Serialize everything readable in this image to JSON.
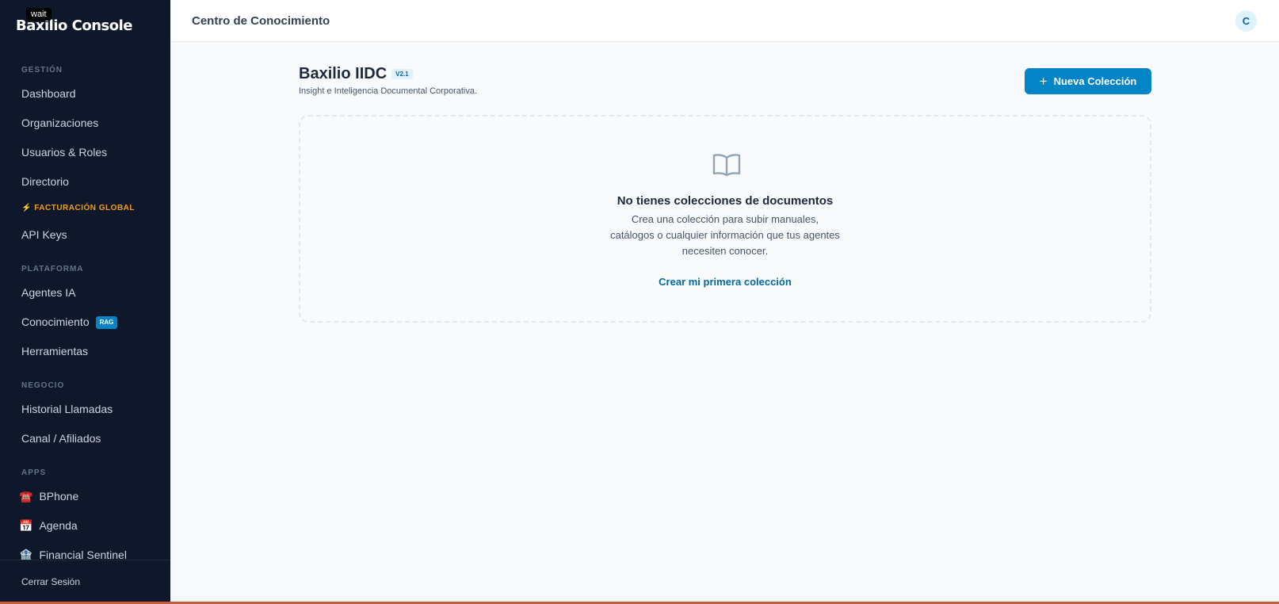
{
  "sidebar": {
    "brand": "Baxilio Console",
    "tooltip": "wait",
    "sections": {
      "gestion": "GESTIÓN",
      "plataforma": "PLATAFORMA",
      "negocio": "NEGOCIO",
      "apps": "APPS"
    },
    "items": {
      "dashboard": "Dashboard",
      "organizaciones": "Organizaciones",
      "usuarios": "Usuarios & Roles",
      "directorio": "Directorio",
      "facturacion": "⚡ FACTURACIÓN GLOBAL",
      "api_keys": "API Keys",
      "agentes": "Agentes IA",
      "conocimiento": "Conocimiento",
      "conocimiento_badge": "RAG",
      "herramientas": "Herramientas",
      "historial": "Historial Llamadas",
      "canal": "Canal / Afiliados",
      "bphone": "BPhone",
      "agenda": "Agenda",
      "financial": "Financial Sentinel"
    },
    "icons": {
      "bphone": "☎️",
      "agenda": "📅",
      "financial": "🏦"
    },
    "logout": "Cerrar Sesión"
  },
  "header": {
    "title": "Centro de Conocimiento",
    "avatar_initial": "C"
  },
  "main": {
    "title": "Baxilio IIDC",
    "version": "V2.1",
    "subtitle": "Insight e Inteligencia Documental Corporativa.",
    "new_button": "Nueva Colección",
    "empty": {
      "title": "No tienes colecciones de documentos",
      "desc_line1": "Crea una colección para subir manuales,",
      "desc_line2": "catálogos o cualquier información que tus agentes",
      "desc_line3": "necesiten conocer.",
      "link": "Crear mi primera colección"
    }
  },
  "colors": {
    "accent": "#0284c7",
    "sidebar_bg": "#0f172a",
    "billing": "#f59e0b"
  }
}
